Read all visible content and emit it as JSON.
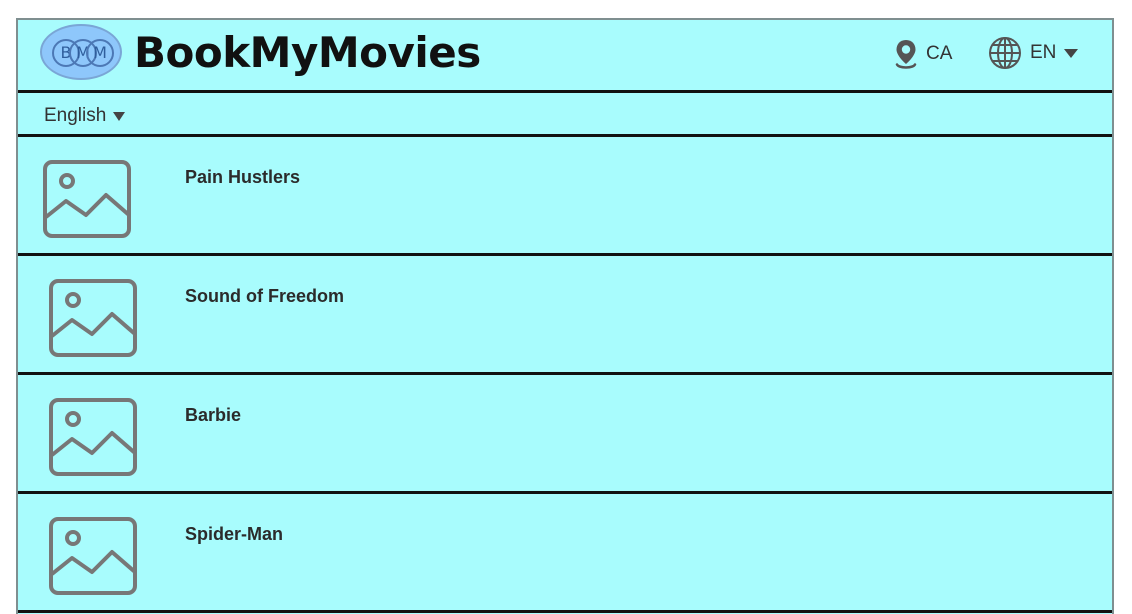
{
  "header": {
    "logo_letters": [
      "B",
      "M",
      "M"
    ],
    "brand": "BookMyMovies",
    "location": {
      "icon": "location-pin-icon",
      "label": "CA"
    },
    "language": {
      "icon": "globe-icon",
      "label": "EN"
    }
  },
  "filter": {
    "language_label": "English"
  },
  "movies": [
    {
      "title": "Pain Hustlers",
      "thumbnail_icon": "image-placeholder-icon"
    },
    {
      "title": "Sound of Freedom",
      "thumbnail_icon": "image-placeholder-icon"
    },
    {
      "title": "Barbie",
      "thumbnail_icon": "image-placeholder-icon"
    },
    {
      "title": "Spider-Man",
      "thumbnail_icon": "image-placeholder-icon"
    }
  ],
  "colors": {
    "background": "#a8fcfd",
    "logo_fill": "#8ec7fb",
    "divider": "#111111",
    "icon_gray": "#7a7a7a"
  }
}
